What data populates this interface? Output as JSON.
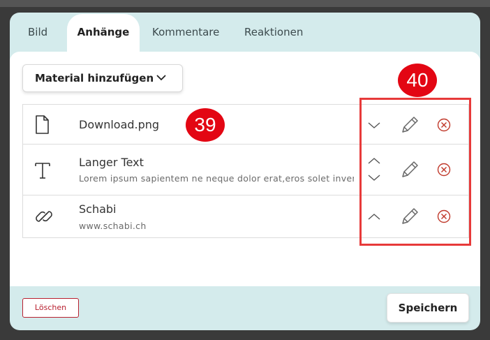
{
  "tabs": [
    {
      "label": "Bild"
    },
    {
      "label": "Anhänge"
    },
    {
      "label": "Kommentare"
    },
    {
      "label": "Reaktionen"
    }
  ],
  "add_material": {
    "label": "Material hinzufügen",
    "icon": "chevron-down-icon"
  },
  "attachments": [
    {
      "icon": "file-icon",
      "title": "Download.png",
      "subtitle": ""
    },
    {
      "icon": "text-icon",
      "title": "Langer Text",
      "subtitle": "Lorem ipsum sapientem ne neque dolor erat,eros solet invenire liber eu."
    },
    {
      "icon": "link-icon",
      "title": "Schabi",
      "subtitle": "www.schabi.ch"
    }
  ],
  "markers": {
    "m39": "39",
    "m40": "40"
  },
  "footer": {
    "delete_label": "Löschen",
    "save_label": "Speichern"
  },
  "colors": {
    "accent_bg": "#d4ebec",
    "marker": "#e30613",
    "highlight_box": "#e73a3a",
    "delete": "#c0392b"
  }
}
